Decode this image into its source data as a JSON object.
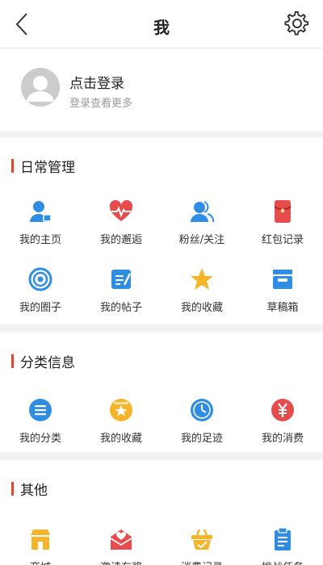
{
  "header": {
    "title": "我"
  },
  "profile": {
    "login_text": "点击登录",
    "sub_text": "登录查看更多"
  },
  "sections": [
    {
      "title": "日常管理",
      "items": [
        {
          "label": "我的主页",
          "icon": "user-home-icon"
        },
        {
          "label": "我的邂逅",
          "icon": "heartbeat-icon"
        },
        {
          "label": "粉丝/关注",
          "icon": "fans-icon"
        },
        {
          "label": "红包记录",
          "icon": "red-envelope-icon"
        },
        {
          "label": "我的圈子",
          "icon": "circle-target-icon"
        },
        {
          "label": "我的帖子",
          "icon": "post-icon"
        },
        {
          "label": "我的收藏",
          "icon": "star-icon"
        },
        {
          "label": "草稿箱",
          "icon": "drafts-tray-icon"
        }
      ]
    },
    {
      "title": "分类信息",
      "items": [
        {
          "label": "我的分类",
          "icon": "list-circle-icon"
        },
        {
          "label": "我的收藏",
          "icon": "star-circle-icon"
        },
        {
          "label": "我的足迹",
          "icon": "clock-icon"
        },
        {
          "label": "我的消费",
          "icon": "yen-circle-icon"
        }
      ]
    },
    {
      "title": "其他",
      "items": [
        {
          "label": "商城",
          "icon": "shop-icon"
        },
        {
          "label": "邀请有奖",
          "icon": "invite-mail-icon"
        },
        {
          "label": "消费记录",
          "icon": "basket-icon"
        },
        {
          "label": "挑战任务",
          "icon": "clipboard-icon"
        }
      ]
    }
  ],
  "colors": {
    "accent": "#e0452e",
    "blue": "#2f8de4",
    "red": "#e74c4c",
    "yellow": "#f5b52a"
  }
}
